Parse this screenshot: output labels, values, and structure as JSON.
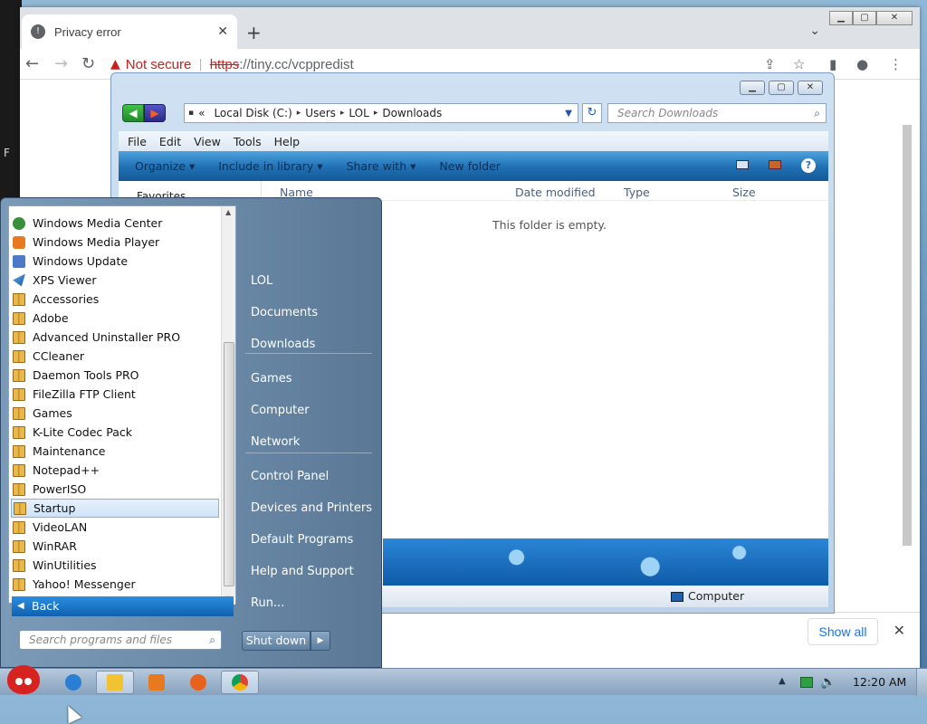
{
  "desktop": {
    "left_badge": "F"
  },
  "chrome": {
    "tab_title": "Privacy error",
    "new_tab": "+",
    "warning": "Not secure",
    "url_scheme": "https",
    "url_rest": "://tiny.cc/vcppredist",
    "download_bar": {
      "show_all": "Show all"
    }
  },
  "explorer": {
    "breadcrumb": [
      "Local Disk (C:)",
      "Users",
      "LOL",
      "Downloads"
    ],
    "search_placeholder": "Search Downloads",
    "menu": [
      "File",
      "Edit",
      "View",
      "Tools",
      "Help"
    ],
    "commands": [
      "Organize ▾",
      "Include in library ▾",
      "Share with ▾",
      "New folder"
    ],
    "nav_pane_item": "Favorites",
    "columns": [
      "Name",
      "Date modified",
      "Type",
      "Size"
    ],
    "empty_message": "This folder is empty.",
    "status_location": "Computer"
  },
  "start_menu": {
    "programs": [
      {
        "label": "Windows Media Center",
        "icon": "wmc"
      },
      {
        "label": "Windows Media Player",
        "icon": "wmp"
      },
      {
        "label": "Windows Update",
        "icon": "wu"
      },
      {
        "label": "XPS Viewer",
        "icon": "xps"
      },
      {
        "label": "Accessories",
        "icon": "folder"
      },
      {
        "label": "Adobe",
        "icon": "folder"
      },
      {
        "label": "Advanced Uninstaller PRO",
        "icon": "folder"
      },
      {
        "label": "CCleaner",
        "icon": "folder"
      },
      {
        "label": "Daemon Tools PRO",
        "icon": "folder"
      },
      {
        "label": "FileZilla FTP Client",
        "icon": "folder"
      },
      {
        "label": "Games",
        "icon": "folder"
      },
      {
        "label": "K-Lite Codec Pack",
        "icon": "folder"
      },
      {
        "label": "Maintenance",
        "icon": "folder"
      },
      {
        "label": "Notepad++",
        "icon": "folder"
      },
      {
        "label": "PowerISO",
        "icon": "folder"
      },
      {
        "label": "Startup",
        "icon": "folder",
        "selected": true
      },
      {
        "label": "VideoLAN",
        "icon": "folder"
      },
      {
        "label": "WinRAR",
        "icon": "folder"
      },
      {
        "label": "WinUtilities",
        "icon": "folder"
      },
      {
        "label": "Yahoo! Messenger",
        "icon": "folder"
      }
    ],
    "back": "Back",
    "search_placeholder": "Search programs and files",
    "right_items": [
      "LOL",
      "Documents",
      "Downloads",
      "Games",
      "Computer",
      "Network",
      "Control Panel",
      "Devices and Printers",
      "Default Programs",
      "Help and Support",
      "Run..."
    ],
    "shutdown": "Shut down"
  },
  "taskbar": {
    "clock": "12:20 AM"
  }
}
